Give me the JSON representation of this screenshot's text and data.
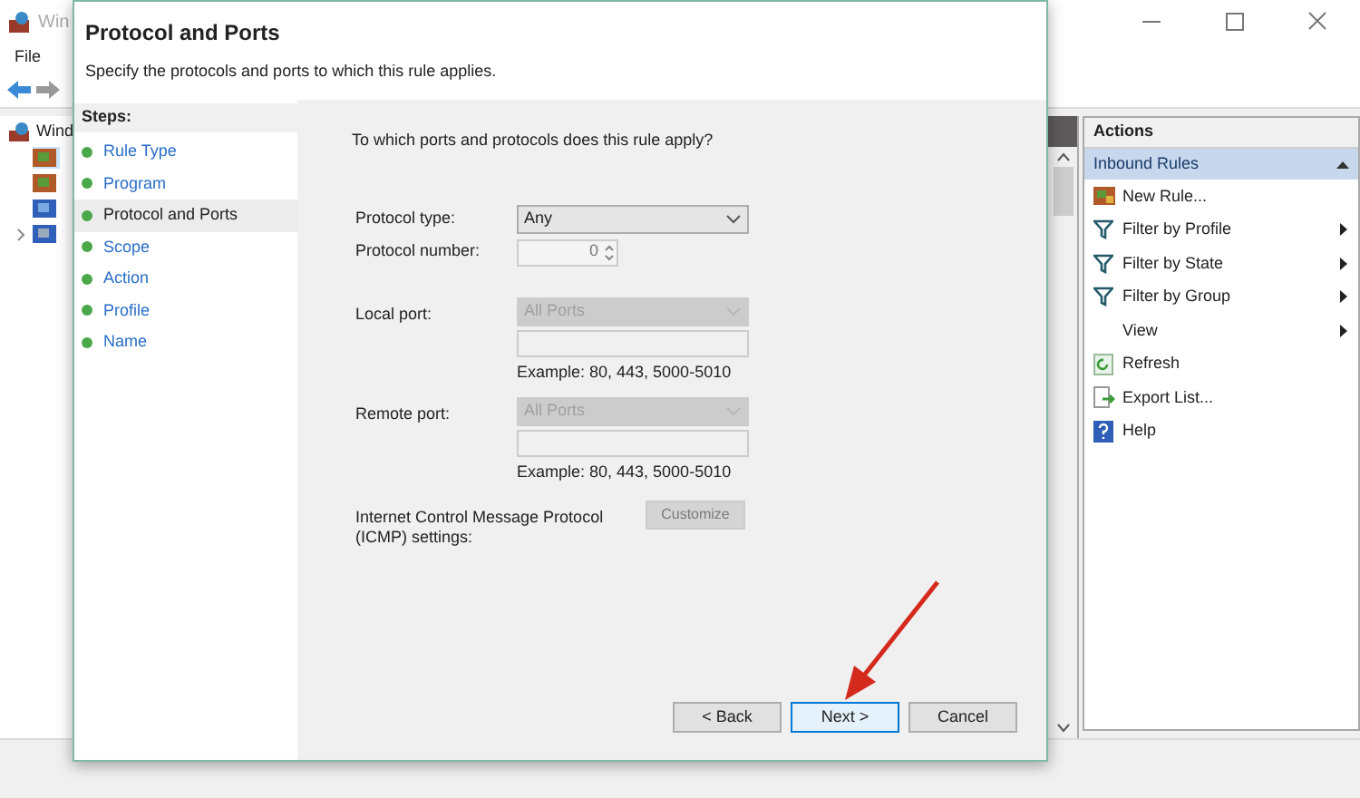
{
  "main_window": {
    "title": "Win",
    "menu": [
      "File"
    ],
    "tree": [
      {
        "label": "Wind",
        "children": [
          {
            "expandable": false,
            "selected": true
          },
          {
            "expandable": false,
            "selected": false
          },
          {
            "expandable": false,
            "selected": false
          },
          {
            "expandable": true,
            "selected": false
          }
        ]
      }
    ],
    "actions": {
      "header": "Actions",
      "section": "Inbound Rules",
      "items": [
        {
          "label": "New Rule...",
          "kind": "new-rule",
          "submenu": false
        },
        {
          "label": "Filter by Profile",
          "kind": "filter",
          "submenu": true
        },
        {
          "label": "Filter by State",
          "kind": "filter",
          "submenu": true
        },
        {
          "label": "Filter by Group",
          "kind": "filter",
          "submenu": true
        },
        {
          "label": "View",
          "kind": "none",
          "submenu": true
        },
        {
          "label": "Refresh",
          "kind": "refresh",
          "submenu": false
        },
        {
          "label": "Export List...",
          "kind": "export",
          "submenu": false
        },
        {
          "label": "Help",
          "kind": "help",
          "submenu": false
        }
      ]
    }
  },
  "dialog": {
    "title": "Protocol and Ports",
    "subtitle": "Specify the protocols and ports to which this rule applies.",
    "steps_header": "Steps:",
    "steps": [
      {
        "label": "Rule Type",
        "selected": false
      },
      {
        "label": "Program",
        "selected": false
      },
      {
        "label": "Protocol and Ports",
        "selected": true
      },
      {
        "label": "Scope",
        "selected": false
      },
      {
        "label": "Action",
        "selected": false
      },
      {
        "label": "Profile",
        "selected": false
      },
      {
        "label": "Name",
        "selected": false
      }
    ],
    "question": "To which ports and protocols does this rule apply?",
    "protocol_type": {
      "label": "Protocol type:",
      "value": "Any",
      "disabled": false
    },
    "protocol_number": {
      "label": "Protocol number:",
      "value": "0",
      "disabled": true
    },
    "local_port": {
      "label": "Local port:",
      "value": "All Ports",
      "disabled": true,
      "example": "Example: 80, 443, 5000-5010"
    },
    "remote_port": {
      "label": "Remote port:",
      "value": "All Ports",
      "disabled": true,
      "example": "Example: 80, 443, 5000-5010"
    },
    "icmp": {
      "label": "Internet Control Message Protocol (ICMP) settings:",
      "button": "Customize",
      "disabled": true
    },
    "buttons": [
      {
        "label": "< Back",
        "default": false
      },
      {
        "label": "Next >",
        "default": true
      },
      {
        "label": "Cancel",
        "default": false
      }
    ]
  }
}
